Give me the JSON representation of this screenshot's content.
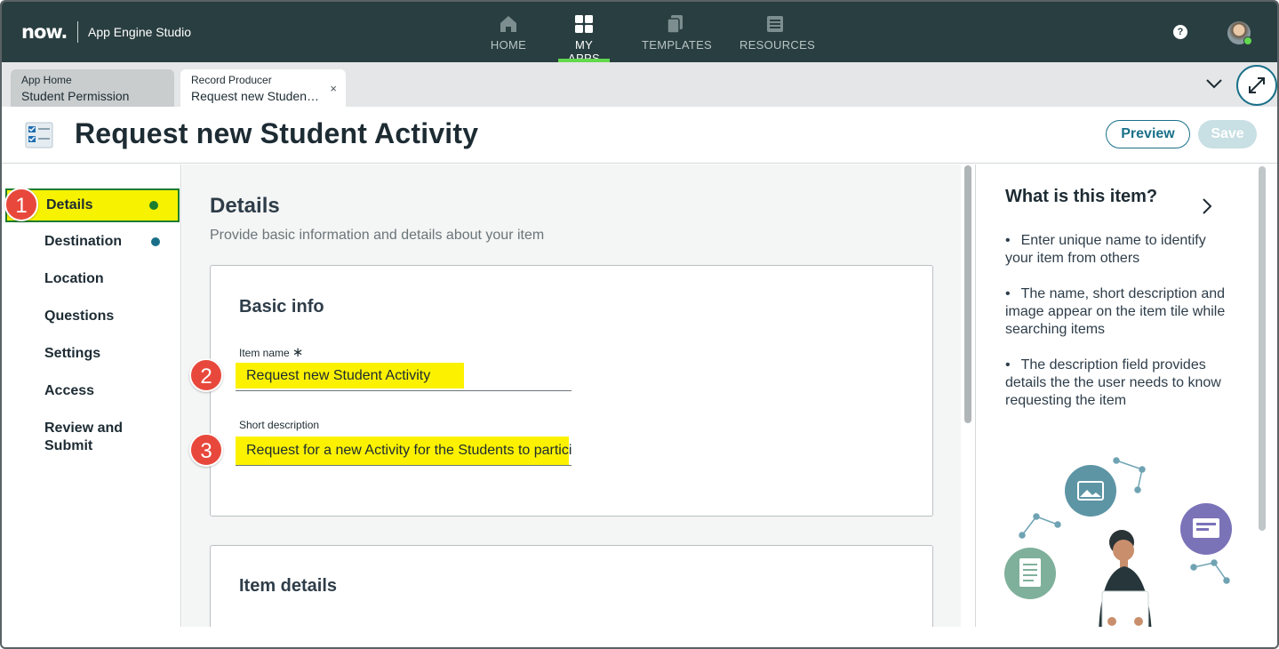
{
  "header": {
    "logo": "now.",
    "app_title": "App Engine Studio",
    "nav": [
      {
        "label": "HOME",
        "icon": "home-icon"
      },
      {
        "label": "MY APPS",
        "icon": "apps-grid-icon",
        "active": true
      },
      {
        "label": "TEMPLATES",
        "icon": "templates-icon"
      },
      {
        "label": "RESOURCES",
        "icon": "resources-icon"
      }
    ],
    "help": "?",
    "active_accent": "#62d84e"
  },
  "tabs": [
    {
      "type": "App Home",
      "name": "Student Permission"
    },
    {
      "type": "Record Producer",
      "name": "Request new Studen…",
      "close": "×"
    }
  ],
  "page": {
    "title": "Request new Student Activity",
    "preview_label": "Preview",
    "save_label": "Save"
  },
  "sidebar": {
    "items": [
      {
        "label": "Details",
        "status": "complete"
      },
      {
        "label": "Destination",
        "status": "in-progress"
      },
      {
        "label": "Location"
      },
      {
        "label": "Questions"
      },
      {
        "label": "Settings"
      },
      {
        "label": "Access"
      },
      {
        "label": "Review and Submit"
      }
    ]
  },
  "main": {
    "title": "Details",
    "subtitle": "Provide basic information and details about your item",
    "basic_info": {
      "title": "Basic info",
      "item_name_label": "Item name",
      "required_mark": "∗",
      "item_name_value": "Request new Student Activity",
      "short_desc_label": "Short description",
      "short_desc_value": "Request for a new Activity for the Students to participate"
    },
    "item_details": {
      "title": "Item details"
    }
  },
  "annotations": [
    "1",
    "2",
    "3"
  ],
  "help_panel": {
    "title": "What is this item?",
    "bullets": [
      "Enter unique name to identify your item from others",
      "The name, short description and image appear on the item tile while searching items",
      "The description field provides details the the user needs to know requesting the item"
    ]
  },
  "colors": {
    "header_bg": "#293e40",
    "accent": "#1a7089",
    "highlight": "#fcf200",
    "badge": "#e8483c",
    "complete_dot": "#1d7d2e",
    "progress_dot": "#1a7089"
  }
}
